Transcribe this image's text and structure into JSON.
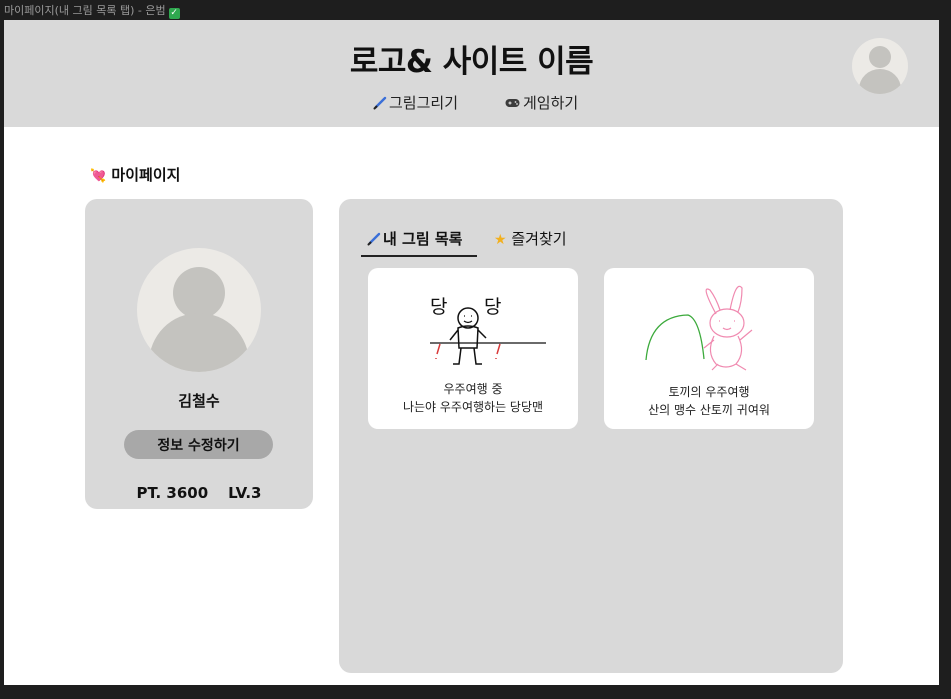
{
  "window": {
    "title": "마이페이지(내 그림 목록 탭) - 은범",
    "check_icon": "check-mark-icon"
  },
  "header": {
    "site_title": "로고& 사이트 이름",
    "nav": [
      {
        "label": "그림그리기",
        "icon": "paintbrush-icon"
      },
      {
        "label": "게임하기",
        "icon": "gamepad-icon"
      }
    ],
    "avatar_icon": "user-avatar-icon"
  },
  "section_title": "마이페이지",
  "section_icon": "heart-with-arrow-icon",
  "profile": {
    "name": "김철수",
    "edit_label": "정보 수정하기",
    "points": "PT. 3600",
    "level": "LV.3"
  },
  "tabs": [
    {
      "label": "내 그림 목록",
      "icon": "paintbrush-icon",
      "active": true
    },
    {
      "label": "즐겨찾기",
      "icon": "star-icon",
      "active": false
    }
  ],
  "drawings": [
    {
      "title": "우주여행 중",
      "description": "나는야 우주여행하는 당당맨",
      "doodle_text": [
        "당",
        "당"
      ]
    },
    {
      "title": "토끼의 우주여행",
      "description": "산의 맹수 산토끼 귀여워"
    }
  ],
  "colors": {
    "header_bg": "#d9d9d9",
    "card_bg": "#d9d9d9",
    "button_bg": "#a8a8a8",
    "avatar_bg": "#eceae6",
    "avatar_fg": "#c4c3bf",
    "rabbit_stroke": "#f08ab0",
    "hill_stroke": "#3caa3c"
  }
}
